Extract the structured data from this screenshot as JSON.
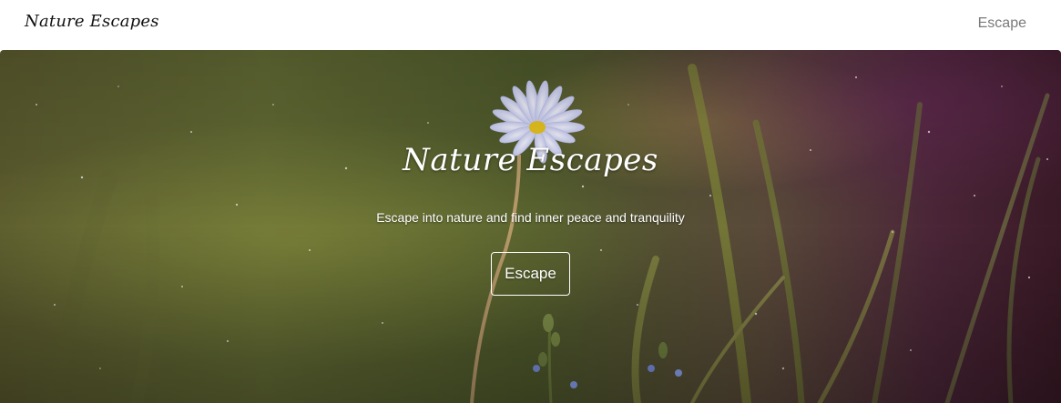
{
  "navbar": {
    "brand": "Nature Escapes",
    "link_label": "Escape"
  },
  "hero": {
    "title": "Nature Escapes",
    "subtitle": "Escape into nature and find inner peace and tranquility",
    "button_label": "Escape",
    "image_subject": "daisy-flower-in-grass"
  },
  "colors": {
    "nav_bg": "#ffffff",
    "nav_link": "#7a7a7a",
    "brand_text": "#111111",
    "hero_text": "#ffffff",
    "hero_green": "#5f6a2a",
    "hero_purple": "#4a2238"
  }
}
